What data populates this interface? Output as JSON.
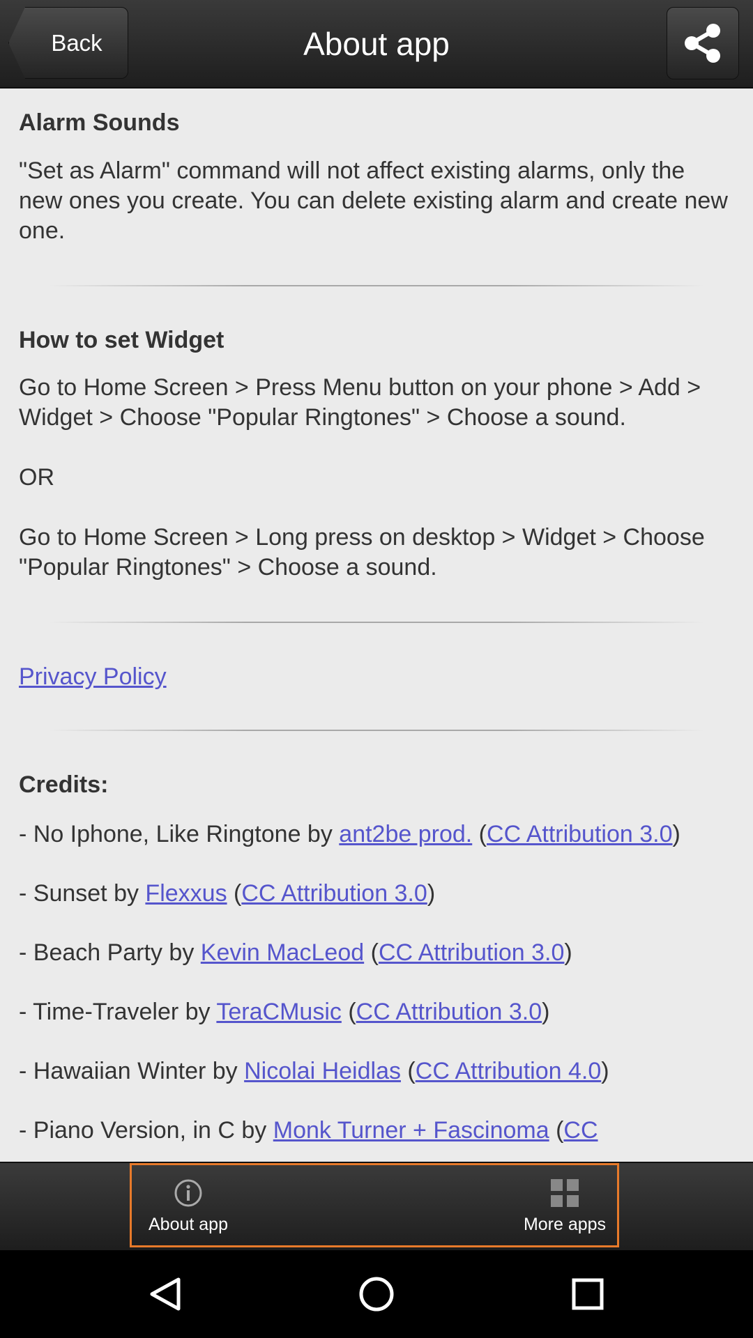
{
  "header": {
    "back_label": "Back",
    "title": "About app",
    "share_icon": "share-icon"
  },
  "sections": {
    "alarm": {
      "heading": "Alarm Sounds",
      "body": "\"Set as Alarm\" command will not affect existing alarms, only the new ones you create. You can delete existing alarm and create new one."
    },
    "widget": {
      "heading": "How to set Widget",
      "body1": "Go to Home Screen > Press Menu button on your phone > Add > Widget > Choose \"Popular Ringtones\" > Choose a sound.",
      "or": "OR",
      "body2": "Go to Home Screen > Long press on desktop > Widget > Choose \"Popular Ringtones\" > Choose a sound."
    },
    "privacy_link": "Privacy Policy",
    "credits": {
      "heading": "Credits:",
      "items": [
        {
          "prefix": "- No Iphone, Like Ringtone by ",
          "author": "ant2be prod.",
          "license": "CC Attribution 3.0"
        },
        {
          "prefix": "- Sunset by ",
          "author": "Flexxus",
          "license": "CC Attribution 3.0"
        },
        {
          "prefix": "- Beach Party by ",
          "author": "Kevin MacLeod",
          "license": "CC Attribution 3.0"
        },
        {
          "prefix": "- Time-Traveler by ",
          "author": "TeraCMusic",
          "license": "CC Attribution 3.0"
        },
        {
          "prefix": "- Hawaiian Winter by ",
          "author": "Nicolai Heidlas",
          "license": "CC Attribution 4.0"
        },
        {
          "prefix": "- Piano Version, in C by ",
          "author": "Monk Turner + Fascinoma",
          "license": "CC"
        }
      ]
    }
  },
  "tabbar": {
    "about_label": "About app",
    "about_icon": "info-icon",
    "more_label": "More apps",
    "more_icon": "grid-icon",
    "highlight_color": "#e87a2a"
  },
  "sysnav": {
    "back_icon": "nav-back-icon",
    "home_icon": "nav-home-icon",
    "recents_icon": "nav-recents-icon"
  }
}
